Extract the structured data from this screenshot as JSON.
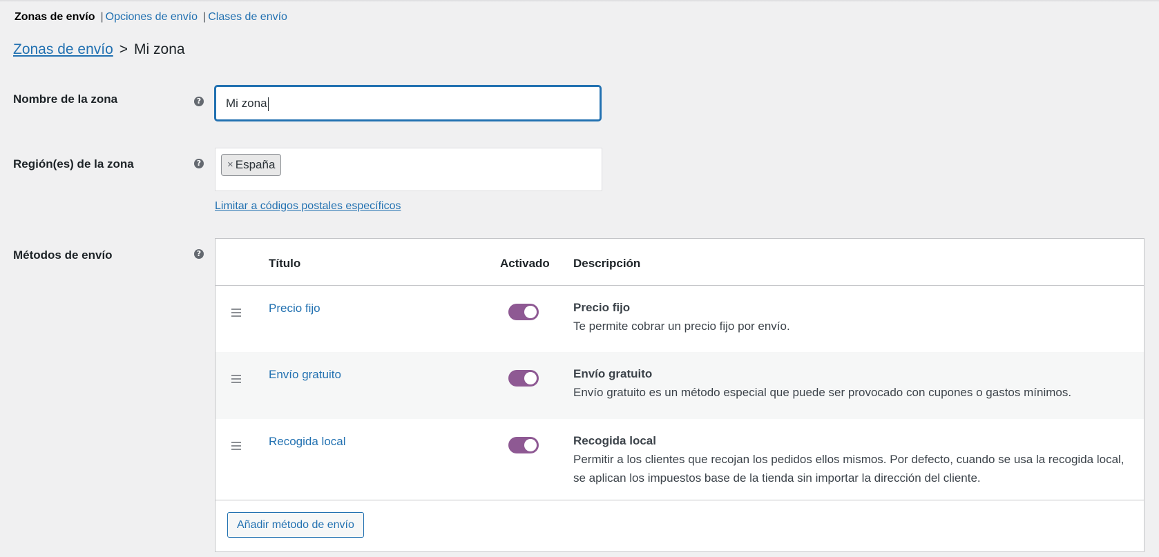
{
  "subnav": {
    "current": "Zonas de envío",
    "separator": "|",
    "links": [
      "Opciones de envío",
      "Clases de envío"
    ]
  },
  "breadcrumb": {
    "parent": "Zonas de envío",
    "separator": ">",
    "current": "Mi zona"
  },
  "zone_name": {
    "label": "Nombre de la zona",
    "value": "Mi zona"
  },
  "zone_regions": {
    "label": "Región(es) de la zona",
    "selected": [
      "España"
    ],
    "remove_glyph": "×",
    "limit_link": "Limitar a códigos postales específicos"
  },
  "help_glyph": "?",
  "shipping_methods": {
    "label": "Métodos de envío",
    "columns": {
      "title": "Título",
      "enabled": "Activado",
      "description": "Descripción"
    },
    "rows": [
      {
        "title": "Precio fijo",
        "enabled": true,
        "desc_title": "Precio fijo",
        "desc_text": "Te permite cobrar un precio fijo por envío."
      },
      {
        "title": "Envío gratuito",
        "enabled": true,
        "desc_title": "Envío gratuito",
        "desc_text": "Envío gratuito es un método especial que puede ser provocado con cupones o gastos mínimos."
      },
      {
        "title": "Recogida local",
        "enabled": true,
        "desc_title": "Recogida local",
        "desc_text": "Permitir a los clientes que recojan los pedidos ellos mismos. Por defecto, cuando se usa la recogida local, se aplican los impuestos base de la tienda sin importar la dirección del cliente."
      }
    ],
    "add_button": "Añadir método de envío"
  },
  "colors": {
    "link": "#2271b1",
    "toggle_on": "#8e5993",
    "background": "#f0f0f1"
  },
  "icons": {
    "help": "question-circle-icon",
    "drag": "drag-handle-icon",
    "remove": "close-icon"
  }
}
